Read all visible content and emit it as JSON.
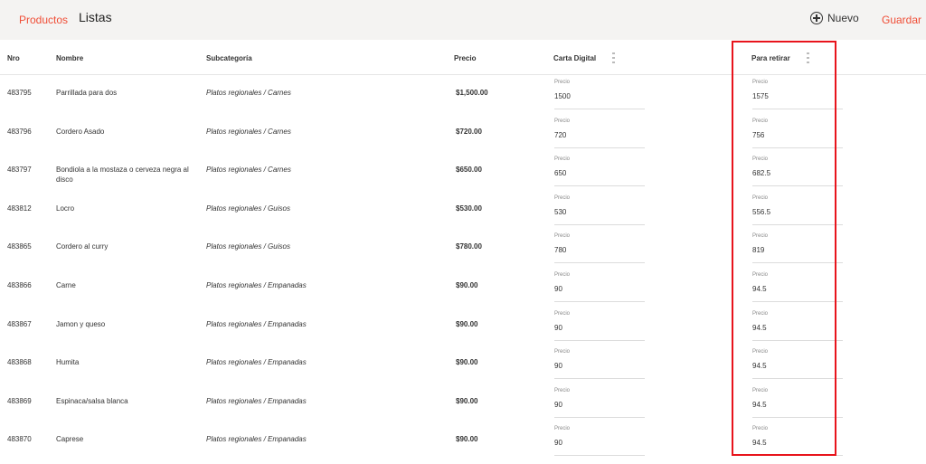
{
  "header": {
    "breadcrumb": "Productos",
    "title": "Listas",
    "new_label": "Nuevo",
    "save_label": "Guardar"
  },
  "colors": {
    "accent": "#f04e37",
    "highlight": "#e8141c",
    "header_bg": "#f4f3f2"
  },
  "table": {
    "columns": {
      "nro": "Nro",
      "nombre": "Nombre",
      "subcategoria": "Subcategoría",
      "precio": "Precio",
      "carta_digital": "Carta Digital",
      "para_retirar": "Para retirar"
    },
    "field_label": "Precio",
    "rows": [
      {
        "nro": "483795",
        "nombre": "Parrillada para dos",
        "subcategoria": "Platos regionales / Carnes",
        "precio": "$1,500.00",
        "carta_digital": "1500",
        "para_retirar": "1575"
      },
      {
        "nro": "483796",
        "nombre": "Cordero Asado",
        "subcategoria": "Platos regionales / Carnes",
        "precio": "$720.00",
        "carta_digital": "720",
        "para_retirar": "756"
      },
      {
        "nro": "483797",
        "nombre": "Bondiola a la mostaza o cerveza negra al disco",
        "subcategoria": "Platos regionales / Carnes",
        "precio": "$650.00",
        "carta_digital": "650",
        "para_retirar": "682.5"
      },
      {
        "nro": "483812",
        "nombre": "Locro",
        "subcategoria": "Platos regionales / Guisos",
        "precio": "$530.00",
        "carta_digital": "530",
        "para_retirar": "556.5"
      },
      {
        "nro": "483865",
        "nombre": "Cordero al curry",
        "subcategoria": "Platos regionales / Guisos",
        "precio": "$780.00",
        "carta_digital": "780",
        "para_retirar": "819"
      },
      {
        "nro": "483866",
        "nombre": "Carne",
        "subcategoria": "Platos regionales / Empanadas",
        "precio": "$90.00",
        "carta_digital": "90",
        "para_retirar": "94.5"
      },
      {
        "nro": "483867",
        "nombre": "Jamon y queso",
        "subcategoria": "Platos regionales / Empanadas",
        "precio": "$90.00",
        "carta_digital": "90",
        "para_retirar": "94.5"
      },
      {
        "nro": "483868",
        "nombre": "Humita",
        "subcategoria": "Platos regionales / Empanadas",
        "precio": "$90.00",
        "carta_digital": "90",
        "para_retirar": "94.5"
      },
      {
        "nro": "483869",
        "nombre": "Espinaca/salsa blanca",
        "subcategoria": "Platos regionales / Empanadas",
        "precio": "$90.00",
        "carta_digital": "90",
        "para_retirar": "94.5"
      },
      {
        "nro": "483870",
        "nombre": "Caprese",
        "subcategoria": "Platos regionales / Empanadas",
        "precio": "$90.00",
        "carta_digital": "90",
        "para_retirar": "94.5"
      }
    ]
  }
}
